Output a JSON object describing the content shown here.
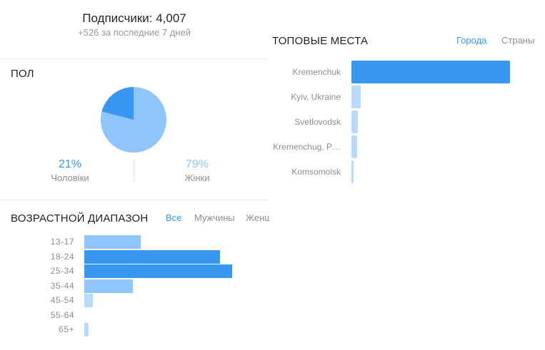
{
  "followers": {
    "title": "Подписчики: 4,007",
    "subtitle": "+526 за последние 7 дней"
  },
  "gender": {
    "title": "ПОЛ",
    "men": {
      "percent": "21%",
      "label": "Чоловіки",
      "value": 0.21,
      "color": "#3897f0"
    },
    "women": {
      "percent": "79%",
      "label": "Жінки",
      "value": 0.79,
      "color": "#8ec5fc"
    }
  },
  "top_places": {
    "title": "ТОПОВЫЕ МЕСТА",
    "tabs": {
      "cities": "Города",
      "countries": "Страны"
    },
    "items": [
      {
        "label": "Kremenchuk",
        "value": 1.0,
        "color": "#3897f0"
      },
      {
        "label": "Kyiv, Ukraine",
        "value": 0.06,
        "color": "#b8dafc"
      },
      {
        "label": "Svetlovodsk",
        "value": 0.04,
        "color": "#b8dafc"
      },
      {
        "label": "Kremenchug, P…",
        "value": 0.035,
        "color": "#b8dafc"
      },
      {
        "label": "Komsomolsk",
        "value": 0.015,
        "color": "#b8dafc"
      }
    ]
  },
  "age": {
    "title": "ВОЗРАСТНОЙ ДИАПАЗОН",
    "tabs": {
      "all": "Все",
      "men": "Мужчины",
      "women": "Женщины"
    },
    "items": [
      {
        "label": "13-17",
        "value": 0.38,
        "color": "#8ec5fc"
      },
      {
        "label": "18-24",
        "value": 0.92,
        "color": "#3897f0"
      },
      {
        "label": "25-34",
        "value": 1.0,
        "color": "#3897f0"
      },
      {
        "label": "35-44",
        "value": 0.33,
        "color": "#8ec5fc"
      },
      {
        "label": "45-54",
        "value": 0.06,
        "color": "#b8dafc"
      },
      {
        "label": "55-64",
        "value": 0.0,
        "color": "#b8dafc"
      },
      {
        "label": "65+",
        "value": 0.03,
        "color": "#b8dafc"
      }
    ]
  }
}
